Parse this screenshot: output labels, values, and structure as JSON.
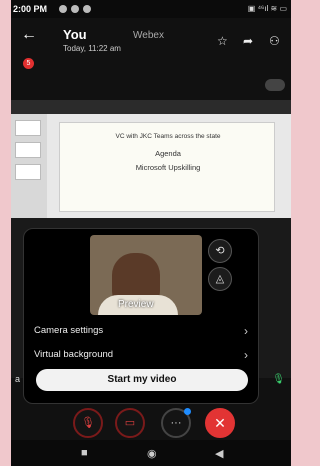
{
  "statusbar": {
    "time": "2:00 PM",
    "right_text": "▣ ⁴⁶ıl ≋ ▭"
  },
  "header": {
    "back_glyph": "←",
    "title": "You",
    "subtitle": "Today, 11:22 am",
    "app_name": "Webex",
    "star_glyph": "☆",
    "share_glyph": "➦",
    "participants_glyph": "⚇",
    "badge_count": "5"
  },
  "slide": {
    "line1": "VC with JKC Teams across the state",
    "line2": "Agenda",
    "line3": "Microsoft Upskilling"
  },
  "side": {
    "label": "a",
    "mic_glyph": "🎙"
  },
  "popup": {
    "preview_label": "Preview",
    "switch_camera_glyph": "⟲",
    "mirror_glyph": "◬",
    "camera_settings": "Camera settings",
    "virtual_background": "Virtual background",
    "chevron": "›",
    "start_button": "Start my video"
  },
  "controls": {
    "mute_glyph": "🎙",
    "video_glyph": "▭",
    "more_glyph": "···",
    "end_glyph": "✕"
  },
  "navbar": {
    "recents": "■",
    "home": "◉",
    "back": "◀"
  },
  "colors": {
    "end_call": "#e23434",
    "mic_active": "#3bd16f",
    "notify_dot": "#1f8cff",
    "outer_bg": "#f0c8cc"
  }
}
